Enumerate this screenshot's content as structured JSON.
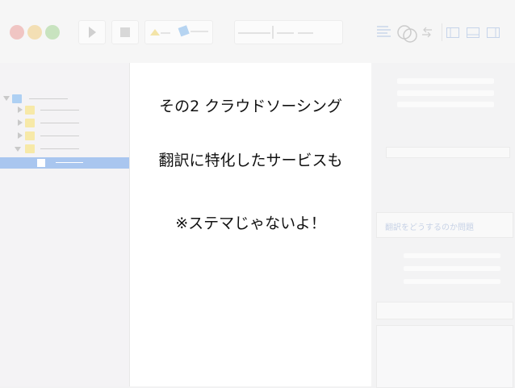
{
  "slide": {
    "line1": "その2 クラウドソーシング",
    "line2": "翻訳に特化したサービスも",
    "line3": "※ステマじゃないよ！"
  },
  "inspector": {
    "faded_label": "翻訳をどうするのか問題"
  },
  "colors": {
    "traffic_red": "#f0c5c3",
    "traffic_yellow": "#f3dfb4",
    "traffic_green": "#c8e3bf",
    "selection": "#a9c6ef",
    "folder": "#f7e9a8",
    "root_folder": "#aed0f3"
  },
  "icons": [
    "play-icon",
    "stop-icon",
    "shapes-icon",
    "text-align-icon",
    "overlap-icon",
    "swap-icon",
    "layout-icons"
  ]
}
